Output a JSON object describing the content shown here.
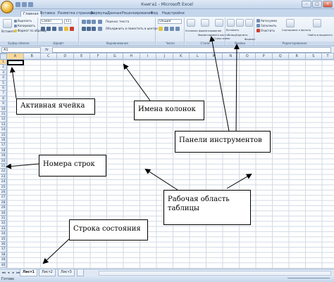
{
  "window": {
    "title": "Книга1 - Microsoft Excel",
    "buttons": [
      "–",
      "□",
      "×"
    ]
  },
  "ribbon": {
    "tabs": [
      "Главная",
      "Вставка",
      "Разметка страницы",
      "Формулы",
      "Данные",
      "Рецензирование",
      "Вид",
      "Надстройки"
    ],
    "active_tab": "Главная",
    "clipboard": {
      "paste": "Вставить",
      "cut": "Вырезать",
      "copy": "Копировать",
      "format_painter": "Формат по образцу",
      "caption": "Буфер обмена"
    },
    "font": {
      "name": "Calibri",
      "size": "11",
      "caption": "Шрифт"
    },
    "alignment": {
      "wrap": "Перенос текста",
      "merge": "Объединить и поместить в центре",
      "caption": "Выравнивание"
    },
    "number": {
      "format": "Общий",
      "caption": "Число"
    },
    "styles": {
      "conditional": "Условное форматирование",
      "as_table": "Форматировать как таблицу",
      "cell_styles": "Стили ячеек",
      "caption": "Стили"
    },
    "cells": {
      "insert": "Вставить",
      "delete": "Удалить",
      "format": "Формат",
      "caption": "Ячейки"
    },
    "editing": {
      "autosum": "Автосумма",
      "fill": "Заполнить",
      "clear": "Очистить",
      "sort": "Сортировка и фильтр",
      "find": "Найти и выделить",
      "caption": "Редактирование"
    }
  },
  "formula_bar": {
    "cell_ref": "A1",
    "fx": "fx",
    "value": ""
  },
  "grid": {
    "columns": [
      "A",
      "B",
      "C",
      "D",
      "E",
      "F",
      "G",
      "H",
      "I",
      "J",
      "K",
      "L",
      "M",
      "N",
      "O",
      "P",
      "Q",
      "R",
      "S",
      "T"
    ],
    "rows": [
      "1",
      "2",
      "3",
      "4",
      "5",
      "6",
      "7",
      "8",
      "9",
      "10",
      "11",
      "12",
      "13",
      "14",
      "15",
      "16",
      "17",
      "18",
      "19",
      "20",
      "21",
      "22",
      "23",
      "24",
      "25",
      "26",
      "27",
      "28",
      "29",
      "30",
      "31",
      "32",
      "33",
      "34",
      "35",
      "36",
      "37",
      "38",
      "39",
      "40"
    ],
    "active_cell": "A1"
  },
  "sheets": {
    "tabs": [
      "Лист1",
      "Лист2",
      "Лист3"
    ],
    "active": "Лист1",
    "nav": [
      "◂◂",
      "◂",
      "▸",
      "▸▸"
    ]
  },
  "status": {
    "text": "Готово"
  },
  "callouts": {
    "active_cell": "Активная ячейка",
    "column_names": "Имена колонок",
    "toolbars": "Панели инструментов",
    "row_numbers": "Номера строк",
    "work_area_line1": "Рабочая область",
    "work_area_line2": "таблицы",
    "status_bar": "Строка состояния"
  }
}
